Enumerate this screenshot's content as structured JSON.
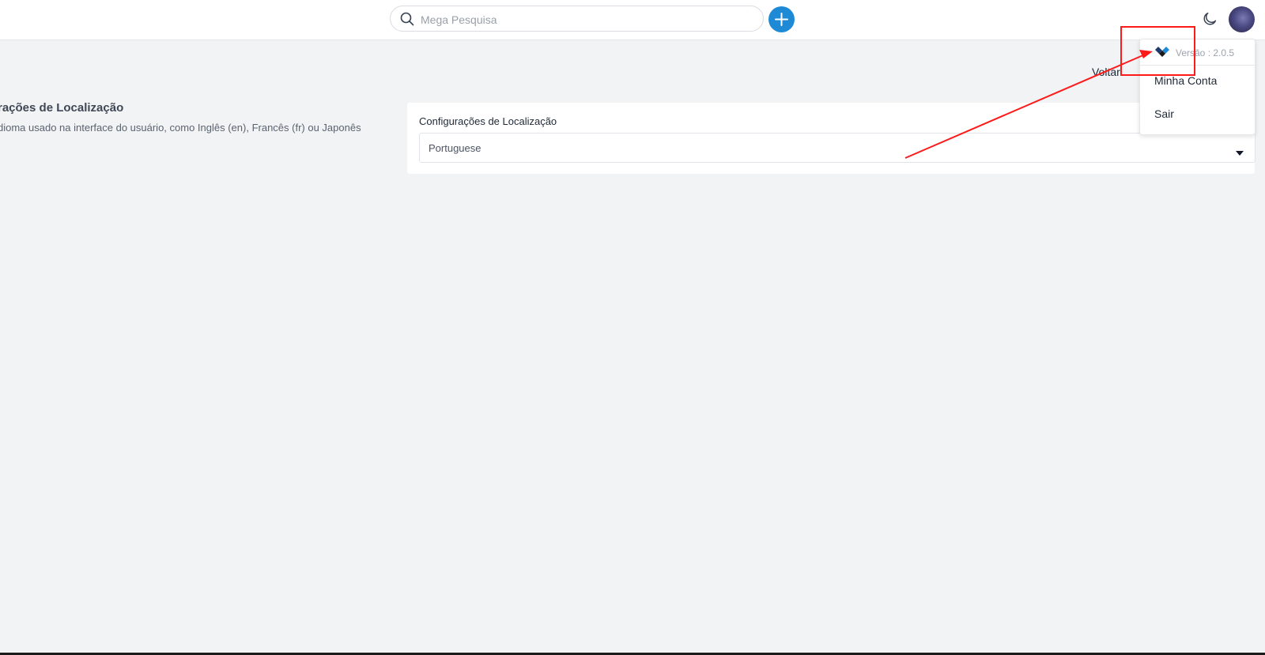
{
  "search": {
    "placeholder": "Mega Pesquisa",
    "icon": "search-icon"
  },
  "header": {
    "add_icon": "plus-icon",
    "theme_icon": "moon-icon",
    "avatar_icon": "user-avatar"
  },
  "toolbar": {
    "back_label": "Voltar"
  },
  "section": {
    "title": "rações de Localização",
    "description": "dioma usado na interface do usuário, como Inglês (en), Francês (fr) ou Japonês"
  },
  "form": {
    "field_label": "Configurações de Localização",
    "selected_value": "Portuguese"
  },
  "user_menu": {
    "version_text": "Versão : 2.0.5",
    "items": [
      {
        "label": "Minha Conta"
      },
      {
        "label": "Sair"
      }
    ]
  },
  "colors": {
    "accent": "#1e8ad6",
    "annotation": "#ff1a1a",
    "background": "#f2f3f5"
  }
}
